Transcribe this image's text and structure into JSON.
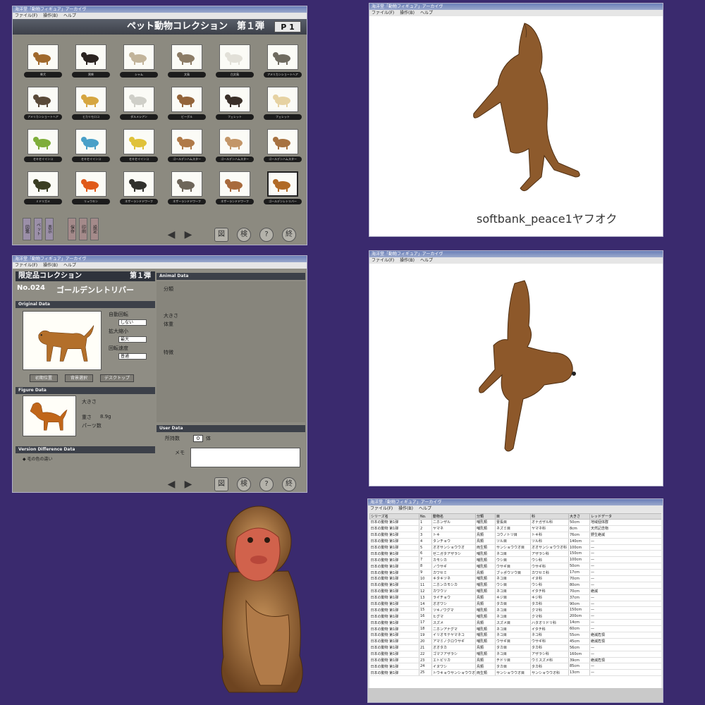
{
  "grid_window": {
    "title": "海洋堂「動物フィギュア」アーカイヴ",
    "menu": [
      "ファイル(F)",
      "操作(B)",
      "ヘルプ"
    ],
    "header_title": "ペット動物コレクション　第１弾",
    "page_label": "P 1",
    "side_buttons": [
      "図鑑",
      "ペット",
      "表示",
      "保存",
      "印刷",
      "設定"
    ],
    "nav": {
      "prev": "◀",
      "next": "▶",
      "b1": "図",
      "b2": "検",
      "b3": "?",
      "b4": "終"
    }
  },
  "grid_items": [
    {
      "caption": "柴犬",
      "color": "#a0692c"
    },
    {
      "caption": "黒柴",
      "color": "#2a2320"
    },
    {
      "caption": "シャム",
      "color": "#c2b49a"
    },
    {
      "caption": "文鳥",
      "color": "#8c7c66"
    },
    {
      "caption": "白文鳥",
      "color": "#e2e0d8"
    },
    {
      "caption": "アメリカンショートヘア",
      "color": "#6f6b60"
    },
    {
      "caption": "アメリカンショートヘア",
      "color": "#5a4a38"
    },
    {
      "caption": "ヒカリモロコ",
      "color": "#d6a640"
    },
    {
      "caption": "ダルメシアン",
      "color": "#cfcfc8"
    },
    {
      "caption": "ビーグル",
      "color": "#93643a"
    },
    {
      "caption": "フェレット",
      "color": "#3a2f28"
    },
    {
      "caption": "フェレット",
      "color": "#e6d2a2"
    },
    {
      "caption": "セキセイインコ",
      "color": "#7fae3a"
    },
    {
      "caption": "セキセイインコ",
      "color": "#4aa0c8"
    },
    {
      "caption": "セキセイインコ",
      "color": "#e0c23a"
    },
    {
      "caption": "ゴールデンハムスター",
      "color": "#b07a48"
    },
    {
      "caption": "ゴールデンハムスター",
      "color": "#c39668"
    },
    {
      "caption": "ゴールデンハムスター",
      "color": "#a77240"
    },
    {
      "caption": "ミドリガメ",
      "color": "#3a3d22"
    },
    {
      "caption": "リュウキン",
      "color": "#e05a1a"
    },
    {
      "caption": "ネザーランドドワーフ",
      "color": "#30302c"
    },
    {
      "caption": "ネザーランドドワーフ",
      "color": "#6e665a"
    },
    {
      "caption": "ネザーランドドワーフ",
      "color": "#a86a3c"
    },
    {
      "caption": "ゴールデンレトリバー",
      "color": "#b06a26"
    }
  ],
  "detail_window": {
    "title": "海洋堂「動物フィギュア」アーカイヴ",
    "menu": [
      "ファイル(F)",
      "操作(B)",
      "ヘルプ"
    ],
    "coll_name": "限定品コレクション",
    "coll_vol": "第１弾",
    "number": "No.024",
    "name": "ゴールデンレトリバー",
    "sec_original": "Original Data",
    "sec_figure": "Figure Data",
    "sec_version": "Version Difference Data",
    "sec_animal": "Animal Data",
    "sec_user": "User Data",
    "lbl_auto": "自動回転",
    "val_auto": "しない",
    "lbl_zoom": "拡大縮小",
    "val_zoom": "最大",
    "lbl_speed": "回転速度",
    "val_speed": "普通",
    "btn_a": "初期位置",
    "btn_b": "背景選択",
    "btn_c": "デスクトップ",
    "fig_size_lbl": "大きさ",
    "fig_weight_lbl": "重さ",
    "fig_parts_lbl": "パーツ数",
    "fig_weight_val": "8.9g",
    "animal_origin_lbl": "分類",
    "animal_size_lbl": "大きさ",
    "animal_size_lbl2": "体重",
    "animal_feature_lbl": "特徴",
    "version_note": "◆ 毛の色の違い",
    "user_owned_lbl": "所持数",
    "user_owned_val": "0",
    "user_owned_unit": "体",
    "user_memo_lbl": "メモ"
  },
  "view3d_top": {
    "title": "海洋堂「動物フィギュア」アーカイヴ",
    "menu": [
      "ファイル(F)",
      "操作(B)",
      "ヘルプ"
    ],
    "watermark": "softbank_peace1ヤフオク"
  },
  "view3d_bottom": {
    "title": "海洋堂「動物フィギュア」アーカイヴ",
    "menu": [
      "ファイル(F)",
      "操作(B)",
      "ヘルプ"
    ]
  },
  "list_window": {
    "title": "海洋堂「動物フィギュア」アーカイヴ",
    "menu": [
      "ファイル(F)",
      "操作(B)",
      "ヘルプ"
    ],
    "columns": [
      "シリーズ名",
      "No.",
      "動物名",
      "分類",
      "目",
      "科",
      "大きさ",
      "レッドデータ"
    ],
    "rows": [
      [
        "日本の動物 第1弾",
        "1",
        "ニホンザル",
        "哺乳類",
        "霊長目",
        "オナガザル科",
        "50cm",
        "地域個体群"
      ],
      [
        "日本の動物 第1弾",
        "2",
        "ヤマネ",
        "哺乳類",
        "ネズミ目",
        "ヤマネ科",
        "8cm",
        "天然記念物"
      ],
      [
        "日本の動物 第1弾",
        "3",
        "トキ",
        "鳥類",
        "コウノトリ目",
        "トキ科",
        "76cm",
        "野生絶滅"
      ],
      [
        "日本の動物 第1弾",
        "4",
        "タンチョウ",
        "鳥類",
        "ツル目",
        "ツル科",
        "140cm",
        "—"
      ],
      [
        "日本の動物 第1弾",
        "5",
        "オオサンショウウオ",
        "両生類",
        "サンショウウオ目",
        "オオサンショウウオ科",
        "100cm",
        "—"
      ],
      [
        "日本の動物 第1弾",
        "6",
        "ゼニガタアザラシ",
        "哺乳類",
        "ネコ目",
        "アザラシ科",
        "150cm",
        "—"
      ],
      [
        "日本の動物 第1弾",
        "7",
        "カモシカ",
        "哺乳類",
        "ウシ目",
        "ウシ科",
        "100cm",
        "—"
      ],
      [
        "日本の動物 第1弾",
        "8",
        "ノウサギ",
        "哺乳類",
        "ウサギ目",
        "ウサギ科",
        "50cm",
        "—"
      ],
      [
        "日本の動物 第1弾",
        "9",
        "カワセミ",
        "鳥類",
        "ブッポウソウ目",
        "カワセミ科",
        "17cm",
        "—"
      ],
      [
        "日本の動物 第1弾",
        "10",
        "キタキツネ",
        "哺乳類",
        "ネコ目",
        "イヌ科",
        "70cm",
        "—"
      ],
      [
        "日本の動物 第1弾",
        "11",
        "ニホンカモシカ",
        "哺乳類",
        "ウシ目",
        "ウシ科",
        "80cm",
        "—"
      ],
      [
        "日本の動物 第1弾",
        "12",
        "カワウソ",
        "哺乳類",
        "ネコ目",
        "イタチ科",
        "70cm",
        "絶滅"
      ],
      [
        "日本の動物 第1弾",
        "13",
        "ライチョウ",
        "鳥類",
        "キジ目",
        "キジ科",
        "37cm",
        "—"
      ],
      [
        "日本の動物 第1弾",
        "14",
        "オオワシ",
        "鳥類",
        "タカ目",
        "タカ科",
        "90cm",
        "—"
      ],
      [
        "日本の動物 第1弾",
        "15",
        "ツキノワグマ",
        "哺乳類",
        "ネコ目",
        "クマ科",
        "150cm",
        "—"
      ],
      [
        "日本の動物 第1弾",
        "16",
        "ヒグマ",
        "哺乳類",
        "ネコ目",
        "クマ科",
        "200cm",
        "—"
      ],
      [
        "日本の動物 第1弾",
        "17",
        "スズメ",
        "鳥類",
        "スズメ目",
        "ハタオリドリ科",
        "14cm",
        "—"
      ],
      [
        "日本の動物 第1弾",
        "18",
        "ニホンアナグマ",
        "哺乳類",
        "ネコ目",
        "イタチ科",
        "60cm",
        "—"
      ],
      [
        "日本の動物 第1弾",
        "19",
        "イリオモテヤマネコ",
        "哺乳類",
        "ネコ目",
        "ネコ科",
        "55cm",
        "絶滅危惧"
      ],
      [
        "日本の動物 第1弾",
        "20",
        "アマミノクロウサギ",
        "哺乳類",
        "ウサギ目",
        "ウサギ科",
        "45cm",
        "絶滅危惧"
      ],
      [
        "日本の動物 第1弾",
        "21",
        "オオタカ",
        "鳥類",
        "タカ目",
        "タカ科",
        "56cm",
        "—"
      ],
      [
        "日本の動物 第1弾",
        "22",
        "ゴマフアザラシ",
        "哺乳類",
        "ネコ目",
        "アザラシ科",
        "160cm",
        "—"
      ],
      [
        "日本の動物 第1弾",
        "23",
        "エトピリカ",
        "鳥類",
        "チドリ目",
        "ウミスズメ科",
        "39cm",
        "絶滅危惧"
      ],
      [
        "日本の動物 第1弾",
        "24",
        "イヌワシ",
        "鳥類",
        "タカ目",
        "タカ科",
        "85cm",
        "—"
      ],
      [
        "日本の動物 第1弾",
        "25",
        "トウキョウサンショウウオ",
        "両生類",
        "サンショウウオ目",
        "サンショウウオ科",
        "13cm",
        "—"
      ]
    ]
  }
}
